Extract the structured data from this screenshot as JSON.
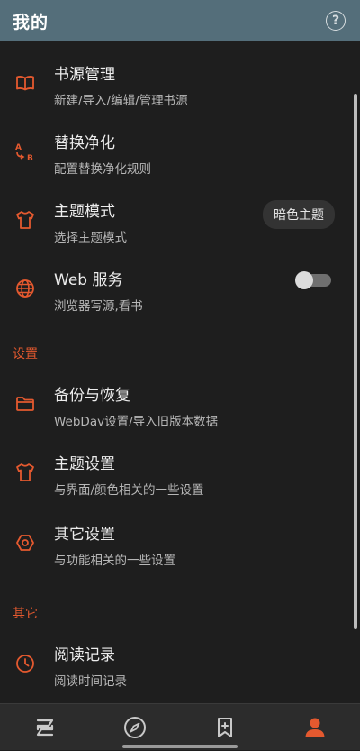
{
  "app_bar": {
    "title": "我的",
    "help_icon": "help-circle-icon"
  },
  "colors": {
    "accent": "#e4592f",
    "app_bar_bg": "#546e7a",
    "background": "#1e1e1e"
  },
  "items": {
    "book_source": {
      "title": "书源管理",
      "subtitle": "新建/导入/编辑/管理书源",
      "icon": "book-icon"
    },
    "replace": {
      "title": "替换净化",
      "subtitle": "配置替换净化规则",
      "icon": "replace-ab-icon"
    },
    "theme_mode": {
      "title": "主题模式",
      "subtitle": "选择主题模式",
      "icon": "shirt-icon",
      "value": "暗色主题"
    },
    "web_service": {
      "title": "Web 服务",
      "subtitle": "浏览器写源,看书",
      "icon": "globe-icon",
      "enabled": false
    },
    "backup": {
      "title": "备份与恢复",
      "subtitle": "WebDav设置/导入旧版本数据",
      "icon": "folder-icon"
    },
    "theme_settings": {
      "title": "主题设置",
      "subtitle": "与界面/颜色相关的一些设置",
      "icon": "shirt-icon"
    },
    "other_settings": {
      "title": "其它设置",
      "subtitle": "与功能相关的一些设置",
      "icon": "hexagon-icon"
    },
    "read_record": {
      "title": "阅读记录",
      "subtitle": "阅读时间记录",
      "icon": "clock-icon"
    }
  },
  "sections": {
    "settings": "设置",
    "other": "其它"
  },
  "bottom_nav": {
    "items": [
      {
        "icon": "bookshelf-icon",
        "selected": false
      },
      {
        "icon": "compass-icon",
        "selected": false
      },
      {
        "icon": "bookmark-add-icon",
        "selected": false
      },
      {
        "icon": "person-icon",
        "selected": true
      }
    ]
  }
}
